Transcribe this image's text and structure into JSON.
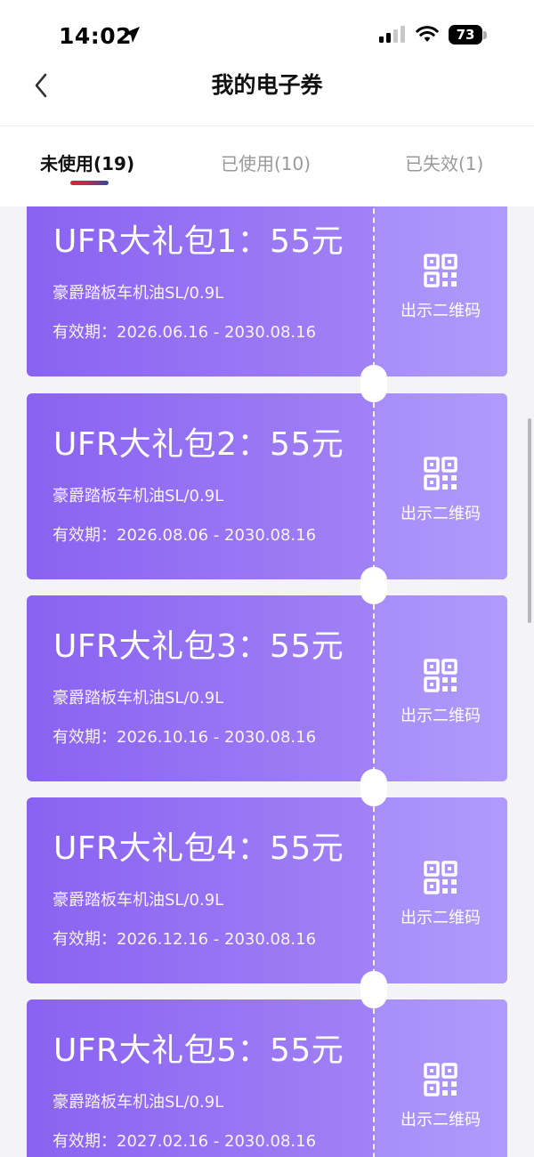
{
  "status_bar": {
    "time": "14:02",
    "battery_level": "73",
    "icons": [
      "location-arrow-icon",
      "cellular-signal-icon",
      "wifi-icon",
      "battery-icon"
    ]
  },
  "nav": {
    "title": "我的电子券",
    "back_icon": "chevron-left-icon"
  },
  "tabs": [
    {
      "label": "未使用(19)",
      "active": true
    },
    {
      "label": "已使用(10)",
      "active": false
    },
    {
      "label": "已失效(1)",
      "active": false
    }
  ],
  "colors": {
    "coupon_gradient_start": "#8a62f2",
    "coupon_gradient_end": "#ac90f8",
    "tab_indicator": [
      "#d7262f",
      "#2f4aa0"
    ]
  },
  "coupons": [
    {
      "title": "UFR大礼包1：55元",
      "product": "豪爵踏板车机油SL/0.9L",
      "validity": "有效期：2026.06.16 - 2030.08.16",
      "action_label": "出示二维码",
      "action_icon": "qr-code-icon"
    },
    {
      "title": "UFR大礼包2：55元",
      "product": "豪爵踏板车机油SL/0.9L",
      "validity": "有效期：2026.08.06 - 2030.08.16",
      "action_label": "出示二维码",
      "action_icon": "qr-code-icon"
    },
    {
      "title": "UFR大礼包3：55元",
      "product": "豪爵踏板车机油SL/0.9L",
      "validity": "有效期：2026.10.16 - 2030.08.16",
      "action_label": "出示二维码",
      "action_icon": "qr-code-icon"
    },
    {
      "title": "UFR大礼包4：55元",
      "product": "豪爵踏板车机油SL/0.9L",
      "validity": "有效期：2026.12.16 - 2030.08.16",
      "action_label": "出示二维码",
      "action_icon": "qr-code-icon"
    },
    {
      "title": "UFR大礼包5：55元",
      "product": "豪爵踏板车机油SL/0.9L",
      "validity": "有效期：2027.02.16 - 2030.08.16",
      "action_label": "出示二维码",
      "action_icon": "qr-code-icon"
    }
  ]
}
